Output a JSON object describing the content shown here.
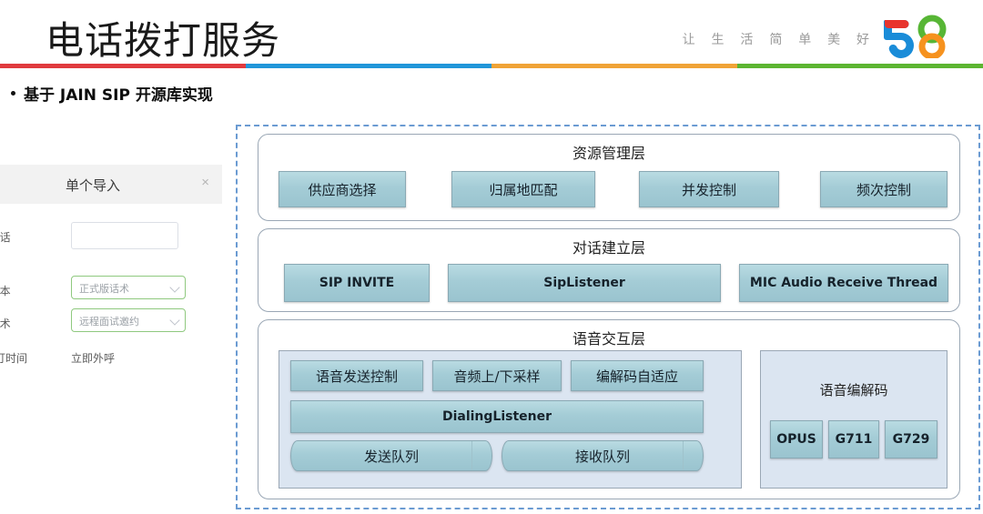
{
  "header": {
    "title": "电话拨打服务",
    "tagline": "让 生 活 简 单 美 好",
    "logo_name": "58-logo",
    "logo_colors": {
      "red": "#e8342d",
      "blue": "#1a8cd8",
      "green": "#57b635",
      "orange": "#f6921e"
    },
    "color_bar": [
      "#e03a3e",
      "#2196d9",
      "#f0a336",
      "#5cb531"
    ]
  },
  "bullet": {
    "text": "基于 JAIN SIP 开源库实现"
  },
  "dialog": {
    "title": "单个导入",
    "close_label": "×",
    "fields": [
      {
        "label": "电话",
        "required": true,
        "type": "input",
        "value": "",
        "placeholder": ""
      },
      {
        "label": "版本",
        "required": true,
        "type": "select",
        "value": "正式版话术"
      },
      {
        "label": "话术",
        "required": true,
        "type": "select",
        "value": "远程面试邀约"
      },
      {
        "label": "拨打时间",
        "required": false,
        "type": "text",
        "value": "立即外呼"
      }
    ]
  },
  "diagram": {
    "layers": [
      {
        "title": "资源管理层",
        "nodes": [
          "供应商选择",
          "归属地匹配",
          "并发控制",
          "频次控制"
        ]
      },
      {
        "title": "对话建立层",
        "nodes": [
          "SIP INVITE",
          "SipListener",
          "MIC Audio Receive Thread"
        ]
      },
      {
        "title": "语音交互层",
        "nodes_top": [
          "语音发送控制",
          "音频上/下采样",
          "编解码自适应"
        ],
        "listener": "DialingListener",
        "queues": [
          "发送队列",
          "接收队列"
        ],
        "codec_panel": {
          "title": "语音编解码",
          "codecs": [
            "OPUS",
            "G711",
            "G729"
          ]
        }
      }
    ]
  }
}
